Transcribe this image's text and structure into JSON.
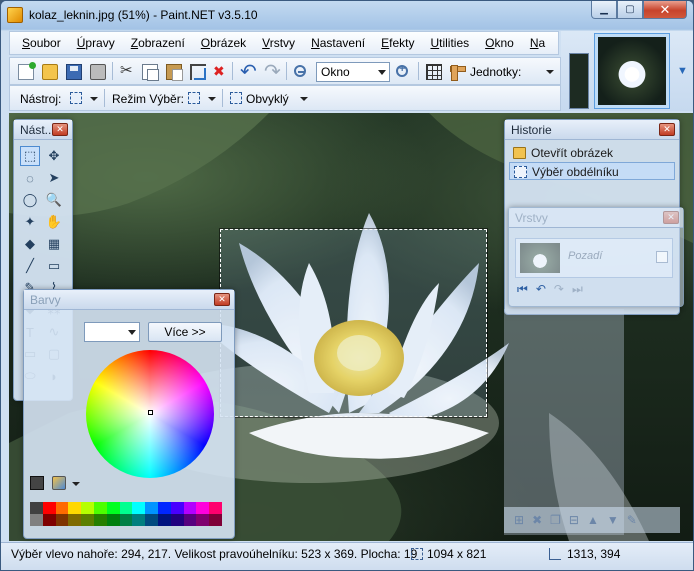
{
  "window": {
    "title": "kolaz_leknin.jpg (51%) - Paint.NET v3.5.10"
  },
  "menu": [
    "Soubor",
    "Úpravy",
    "Zobrazení",
    "Obrázek",
    "Vrstvy",
    "Nastavení",
    "Efekty",
    "Utilities",
    "Okno",
    "Na"
  ],
  "toolbar": {
    "zoom_value": "Okno",
    "units_label": "Jednotky:",
    "tool_label": "Nástroj:",
    "selection_mode_label": "Režim Výběr:",
    "antialias_label": "Obvyklý"
  },
  "tools_panel": {
    "title": "Nást..."
  },
  "colors_panel": {
    "title": "Barvy",
    "more_label": "Více >>",
    "palette_top": [
      "#404040",
      "#ff0000",
      "#ff6a00",
      "#ffd800",
      "#b6ff00",
      "#4cff00",
      "#00ff21",
      "#00ff90",
      "#00ffff",
      "#0094ff",
      "#0026ff",
      "#4800ff",
      "#b200ff",
      "#ff00dc",
      "#ff006e"
    ],
    "palette_bottom": [
      "#808080",
      "#7f0000",
      "#7f3300",
      "#7f6a00",
      "#5b7f00",
      "#267f00",
      "#007f0e",
      "#007f46",
      "#007f7f",
      "#004a7f",
      "#00137f",
      "#21007f",
      "#57007f",
      "#7f006e",
      "#7f0037"
    ]
  },
  "history_panel": {
    "title": "Historie",
    "items": [
      {
        "label": "Otevřít obrázek",
        "icon": "folder-icon"
      },
      {
        "label": "Výběr obdélníku",
        "icon": "rectangle-select-icon"
      }
    ]
  },
  "layers_panel": {
    "title": "Vrstvy",
    "layer_name": "Pozadí"
  },
  "status": {
    "selection_text": "Výběr vlevo nahoře: 294, 217. Velikost pravoúhelníku: 523 x 369. Plocha: 19",
    "image_size": "1094 x 821",
    "cursor_pos": "1313, 394"
  }
}
